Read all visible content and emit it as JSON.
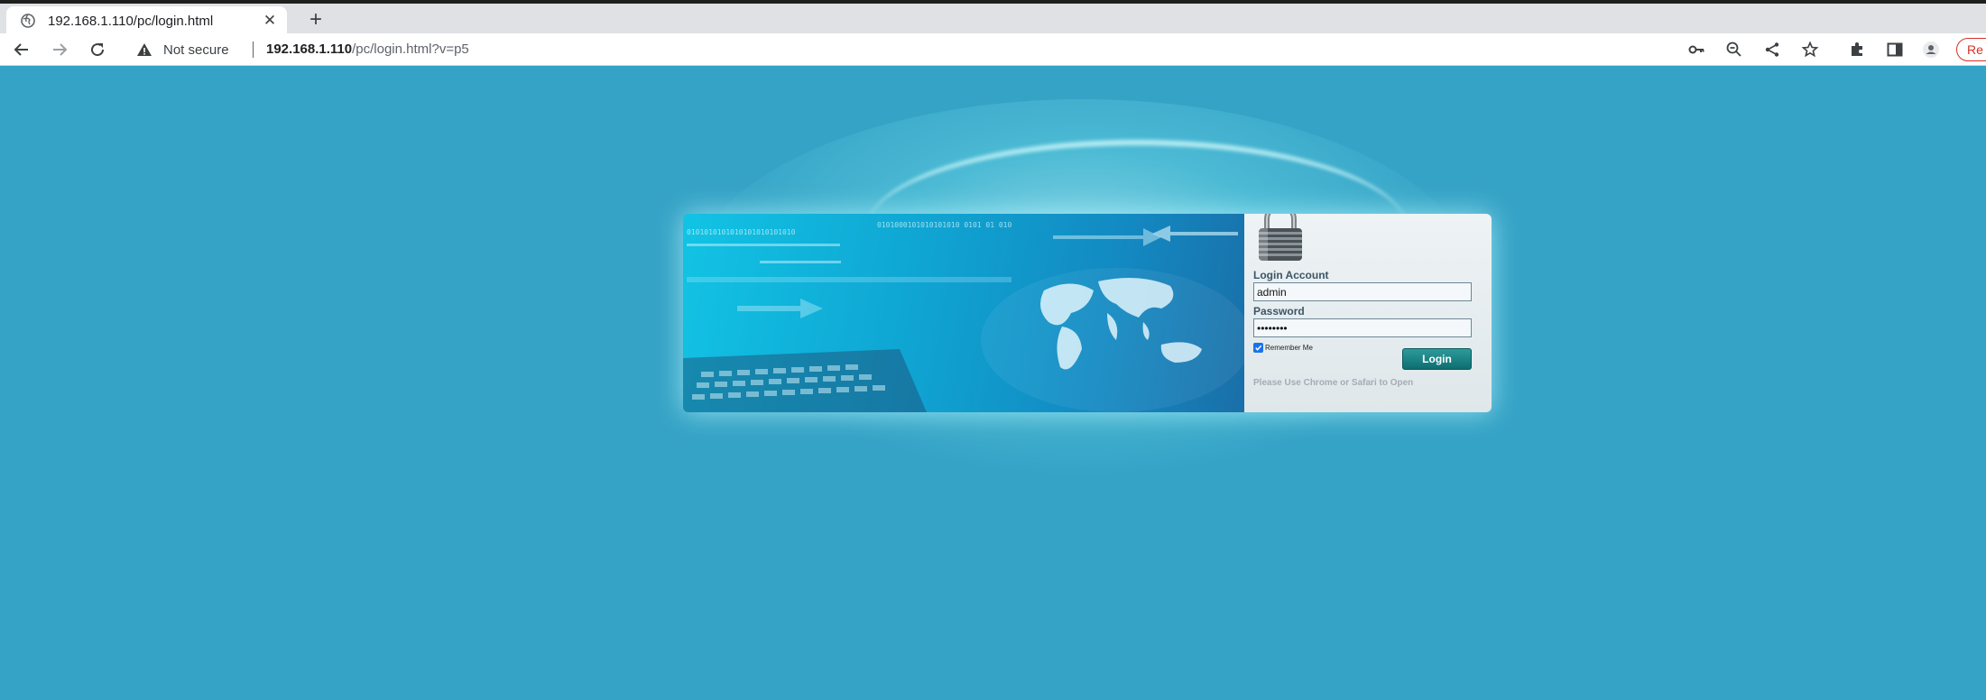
{
  "browser": {
    "tab": {
      "title": "192.168.1.110/pc/login.html",
      "favicon": "globe-icon",
      "close_icon": "close-icon"
    },
    "new_tab_label": "+",
    "nav": {
      "back": "arrow-left-icon",
      "forward": "arrow-right-icon",
      "reload": "reload-icon"
    },
    "address": {
      "security_text": "Not secure",
      "host": "192.168.1.110",
      "path": "/pc/login.html?v=p5"
    },
    "toolbar_icons": [
      "key-icon",
      "zoom-out-icon",
      "share-icon",
      "star-icon",
      "extensions-icon",
      "side-panel-icon",
      "profile-icon"
    ],
    "relaunch_label": "Re"
  },
  "login": {
    "account_label": "Login Account",
    "account_value": "admin",
    "password_label": "Password",
    "password_value": "password",
    "remember_label": "Remember Me",
    "remember_checked": true,
    "login_button": "Login",
    "hint": "Please Use Chrome or Safari to Open"
  },
  "banner": {
    "binary_text_1": "0101000101010101010    0101   01 010",
    "binary_text_2": "0101010101010101010101010"
  },
  "colors": {
    "page_background": "#35a3c6",
    "login_button": "#14777a",
    "chrome_security_red": "#d93025"
  }
}
